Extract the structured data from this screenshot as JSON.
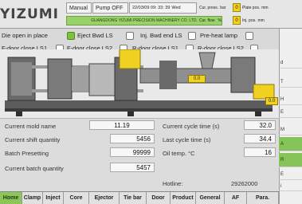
{
  "header": {
    "logo": "YIZUMI",
    "mode": "Manual",
    "pump": "Pump OFF",
    "datetime": "22/03/09 09: 33: 39",
    "wed": "Wed",
    "company": "GUANGDONG YIZUMI PRECISION MACHINERY CO. LTD.",
    "cur_press_label": "Cur. press.",
    "cur_press_unit": "bar",
    "cur_press_value": "0",
    "cur_flow_label": "Cur. flow",
    "cur_flow_unit": "%",
    "cur_flow_value": "0",
    "plate_pos_label": "Plate pos.",
    "plate_pos_unit": "mm",
    "inj_pos_label": "Inj. pos.",
    "inj_pos_unit": "mm"
  },
  "signals": {
    "row1": [
      {
        "label": "Die open in place",
        "on": true
      },
      {
        "label": "Eject Bwd LS",
        "on": false
      },
      {
        "label": "Inj. Bwd end LS",
        "on": false
      },
      {
        "label": "Pre-heat lamp",
        "on": false
      }
    ],
    "row2": [
      {
        "label": "F-door close LS1",
        "on": false
      },
      {
        "label": "F-door close LS2",
        "on": false
      },
      {
        "label": "R-door close LS1",
        "on": false
      },
      {
        "label": "R-door close LS2",
        "on": false
      }
    ]
  },
  "machine": {
    "clamp_pos": "0.0",
    "inj_pos": "0.0"
  },
  "data": {
    "mold_name_label": "Current mold name",
    "mold_name_value": "11.19",
    "shift_qty_label": "Current shift quantity",
    "shift_qty_value": "5456",
    "batch_preset_label": "Batch Presetting",
    "batch_preset_value": "99999",
    "batch_qty_label": "Current batch quantity",
    "batch_qty_value": "5457",
    "cycle_time_label": "Current cycle time  (s)",
    "cycle_time_value": "32.0",
    "last_cycle_label": "Last cycle time  (s)",
    "last_cycle_value": "34.4",
    "oil_temp_label": "Oil temp.  °C",
    "oil_temp_value": "16",
    "hotline_label": "Hotline:",
    "hotline_value": "29262000"
  },
  "tabs": [
    {
      "label": "Home",
      "active": true
    },
    {
      "label": "Clamp"
    },
    {
      "label": "Inject"
    },
    {
      "label": "Core"
    },
    {
      "label": "Ejector"
    },
    {
      "label": "Tie bar"
    },
    {
      "label": "Door"
    },
    {
      "label": "Product"
    },
    {
      "label": "General"
    },
    {
      "label": "AF"
    },
    {
      "label": "Para."
    }
  ],
  "right_panel": [
    "d",
    "T",
    "H",
    "E",
    "M",
    "A",
    "R",
    "E",
    "i"
  ]
}
